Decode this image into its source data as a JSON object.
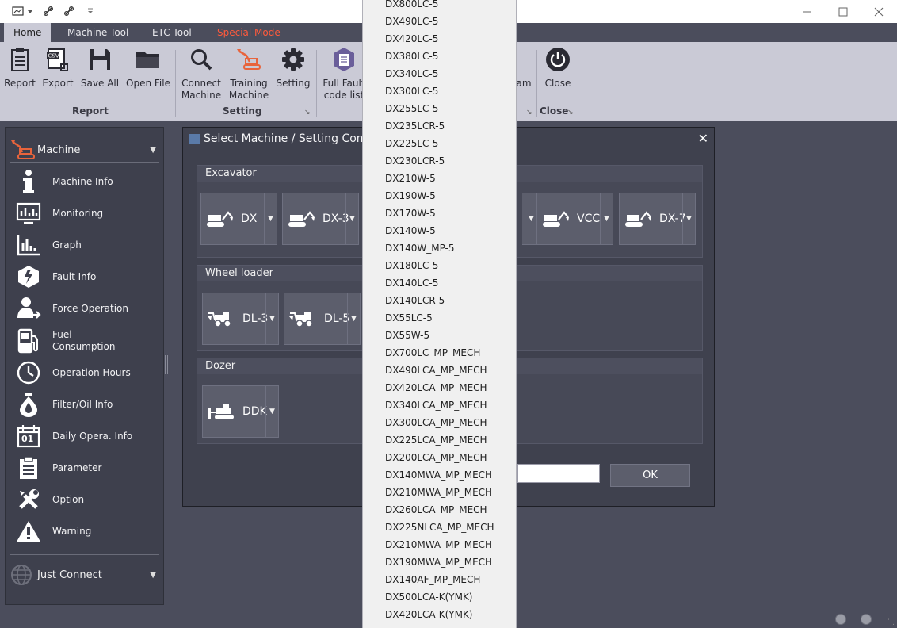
{
  "titlebar": {
    "quick_access": [
      "app-menu-icon",
      "link-icon",
      "link-icon",
      "customize-icon"
    ],
    "controls": [
      "minimize-icon",
      "maximize-icon",
      "close-icon"
    ]
  },
  "tabs": [
    {
      "label": "Home",
      "active": true
    },
    {
      "label": "Machine Tool"
    },
    {
      "label": "ETC Tool"
    },
    {
      "label": "Special Mode",
      "color": "#ff5a3c"
    }
  ],
  "ribbon": {
    "report": {
      "label": "Report",
      "export": "Export",
      "save_all": "Save All",
      "open_file": "Open File",
      "group": "Report"
    },
    "setting": {
      "connect": "Connect\nMachine",
      "training": "Training\nMachine",
      "setting": "Setting",
      "group": "Setting"
    },
    "fault": {
      "full_fault": "Full Fault\ncode list",
      "partial": "am"
    },
    "close": {
      "label": "Close",
      "group": "Close"
    }
  },
  "nav": {
    "machine_header": "Machine",
    "items": [
      {
        "label": "Machine Info",
        "icon": "info-icon"
      },
      {
        "label": "Monitoring",
        "icon": "monitoring-icon"
      },
      {
        "label": "Graph",
        "icon": "graph-icon"
      },
      {
        "label": "Fault Info",
        "icon": "fault-icon"
      },
      {
        "label": "Force Operation",
        "icon": "force-operation-icon"
      },
      {
        "label": "Fuel\nConsumption",
        "icon": "fuel-icon"
      },
      {
        "label": "Operation Hours",
        "icon": "clock-icon"
      },
      {
        "label": "Filter/Oil Info",
        "icon": "oil-drop-icon"
      },
      {
        "label": "Daily Opera. Info",
        "icon": "calendar-icon"
      },
      {
        "label": "Parameter",
        "icon": "clipboard-icon"
      },
      {
        "label": "Option",
        "icon": "tools-icon"
      },
      {
        "label": "Warning",
        "icon": "warning-icon"
      }
    ],
    "just_connect": "Just Connect",
    "calendar_day": "01"
  },
  "dialog": {
    "title": "Select Machine / Setting Com",
    "sections": {
      "excavator": {
        "title": "Excavator",
        "buttons": [
          "DX",
          "DX-3",
          "VCC",
          "DX-7"
        ]
      },
      "wheel_loader": {
        "title": "Wheel loader",
        "buttons": [
          "DL-3",
          "DL-5"
        ]
      },
      "dozer": {
        "title": "Dozer",
        "buttons": [
          "DDK"
        ]
      }
    },
    "ok": "OK"
  },
  "dropdown": {
    "items": [
      "DX800LC-5",
      "DX490LC-5",
      "DX420LC-5",
      "DX380LC-5",
      "DX340LC-5",
      "DX300LC-5",
      "DX255LC-5",
      "DX235LCR-5",
      "DX225LC-5",
      "DX230LCR-5",
      "DX210W-5",
      "DX190W-5",
      "DX170W-5",
      "DX140W-5",
      "DX140W_MP-5",
      "DX180LC-5",
      "DX140LC-5",
      "DX140LCR-5",
      "DX55LC-5",
      "DX55W-5",
      "DX700LC_MP_MECH",
      "DX490LCA_MP_MECH",
      "DX420LCA_MP_MECH",
      "DX340LCA_MP_MECH",
      "DX300LCA_MP_MECH",
      "DX225LCA_MP_MECH",
      "DX200LCA_MP_MECH",
      "DX140MWA_MP_MECH",
      "DX210MWA_MP_MECH",
      "DX260LCA_MP_MECH",
      "DX225NLCA_MP_MECH",
      "DX210MWA_MP_MECH",
      "DX190MWA_MP_MECH",
      "DX140AF_MP_MECH",
      "DX500LCA-K(YMK)",
      "DX420LCA-K(YMK)"
    ]
  },
  "colors": {
    "accent": "#e8643c",
    "special_mode": "#ff5a3c",
    "panel": "#3e404d",
    "ribbon": "#cacad6"
  }
}
